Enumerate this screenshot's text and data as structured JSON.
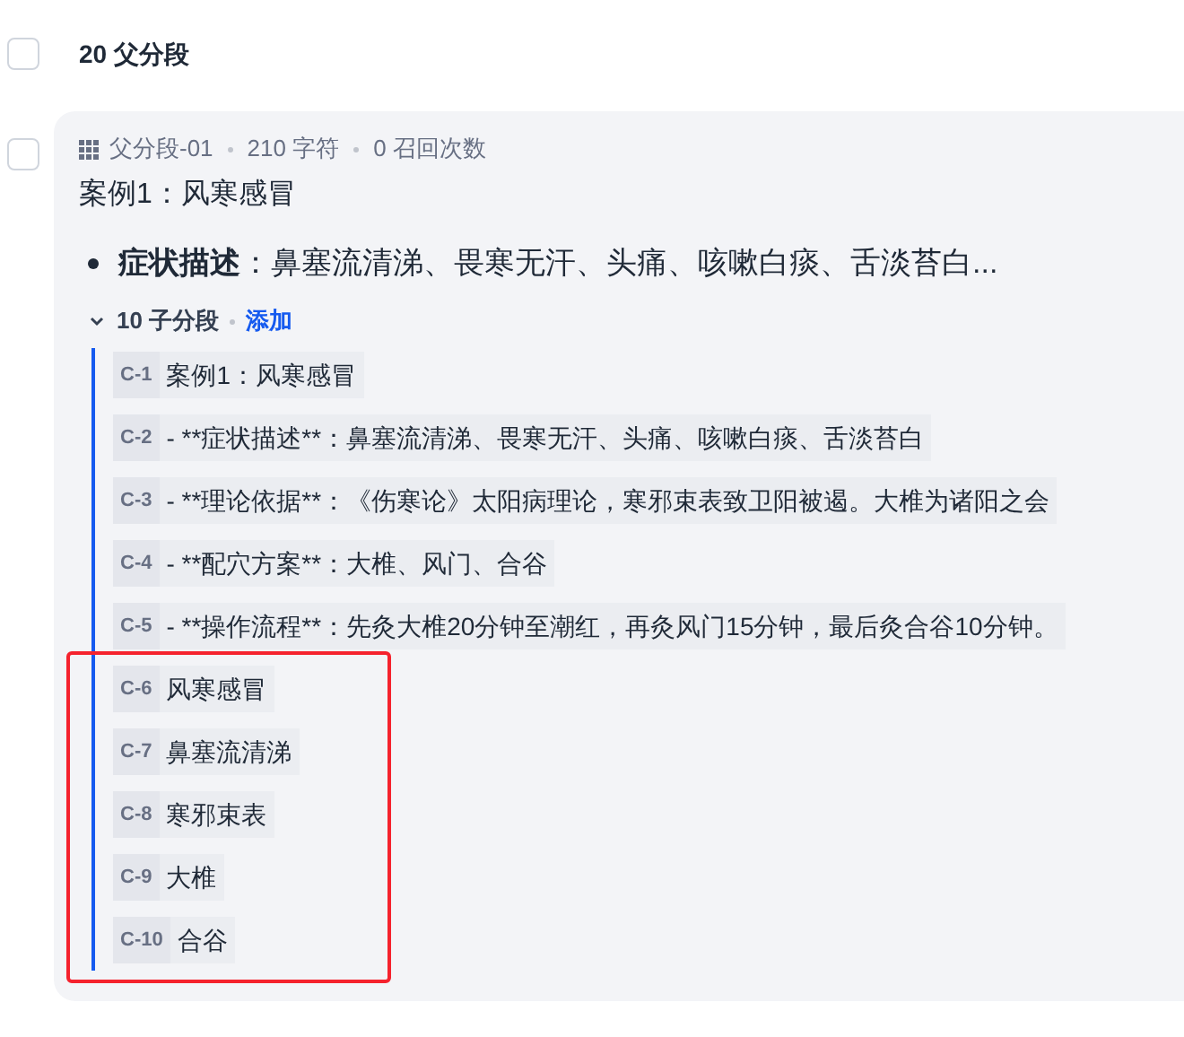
{
  "header": {
    "checked": false,
    "title": "20 父分段"
  },
  "parent": {
    "checked": false,
    "id": "父分段-01",
    "chars": "210 字符",
    "recalls": "0 召回次数",
    "title": "案例1：风寒感冒",
    "bullet": "**症状描述**：鼻塞流清涕、畏寒无汗、头痛、咳嗽白痰、舌淡苔白...",
    "children_header": {
      "expanded": true,
      "count": "10 子分段",
      "add": "添加"
    },
    "chunks": [
      {
        "label": "C-1",
        "text": "案例1：风寒感冒"
      },
      {
        "label": "C-2",
        "text": "- **症状描述**：鼻塞流清涕、畏寒无汗、头痛、咳嗽白痰、舌淡苔白"
      },
      {
        "label": "C-3",
        "text": "- **理论依据**：《伤寒论》太阳病理论，寒邪束表致卫阳被遏。大椎为诸阳之会"
      },
      {
        "label": "C-4",
        "text": "- **配穴方案**：大椎、风门、合谷"
      },
      {
        "label": "C-5",
        "text": "- **操作流程**：先灸大椎20分钟至潮红，再灸风门15分钟，最后灸合谷10分钟。"
      },
      {
        "label": "C-6",
        "text": "风寒感冒"
      },
      {
        "label": "C-7",
        "text": "鼻塞流清涕"
      },
      {
        "label": "C-8",
        "text": "寒邪束表"
      },
      {
        "label": "C-9",
        "text": "大椎"
      },
      {
        "label": "C-10",
        "text": "合谷"
      }
    ]
  }
}
